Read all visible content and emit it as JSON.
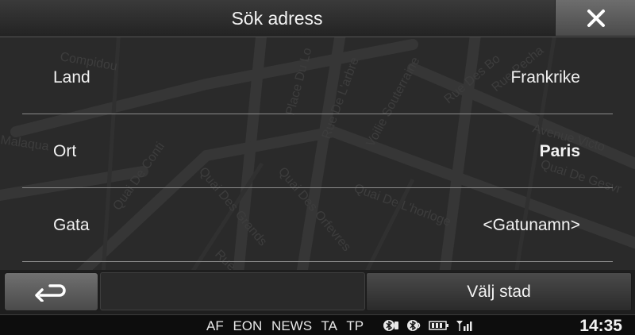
{
  "header": {
    "title": "Sök adress"
  },
  "rows": [
    {
      "label": "Land",
      "value": "Frankrike",
      "bold": false
    },
    {
      "label": "Ort",
      "value": "Paris",
      "bold": true
    },
    {
      "label": "Gata",
      "value": "<Gatunamn>",
      "bold": false
    }
  ],
  "bottom_bar": {
    "select_city_label": "Välj stad"
  },
  "status_bar": {
    "rds": [
      "AF",
      "EON",
      "NEWS",
      "TA",
      "TP"
    ],
    "icons": [
      "bluetooth-phone-icon",
      "bluetooth-audio-icon",
      "battery-icon",
      "signal-strength-icon"
    ],
    "clock": "14:35"
  },
  "map_labels": [
    "Compidou",
    "Place Du Lo",
    "Rue De L'arbre",
    "Voilie Souterraine",
    "Rue Des Bo",
    "Rue Pecha",
    "Avenue Victo",
    "Quai De Gesvr",
    "Malaqua",
    "Quai De Conti",
    "Quai Des Grands",
    "Quai Des Orfevres",
    "Quai De L'horloge",
    "Rue"
  ]
}
